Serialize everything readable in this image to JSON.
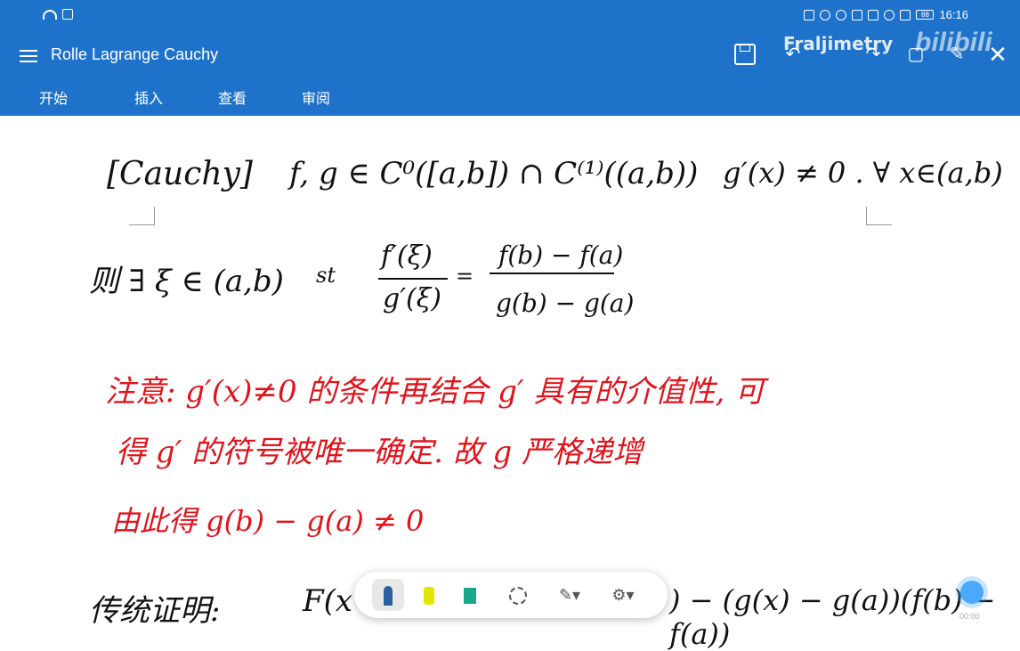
{
  "status": {
    "time": "16:16",
    "battery": "88"
  },
  "header": {
    "title": "Rolle Lagrange Cauchy",
    "watermark": "Fraljimetry",
    "logo": "bilibili",
    "tabs": [
      "开始",
      "插入",
      "查看",
      "审阅"
    ]
  },
  "notes": {
    "line1_label": "[Cauchy]",
    "line1_a": "f, g ∈ C⁰([a,b]) ∩ C⁽¹⁾((a,b))",
    "line1_b": "g′(x) ≠ 0 . ∀ x∈(a,b)",
    "line2_a": "则 ∃ ξ ∈ (a,b)",
    "line2_st": "st",
    "frac1_num": "f′(ξ)",
    "frac1_den": "g′(ξ)",
    "eq": "=",
    "frac2_num": "f(b) − f(a)",
    "frac2_den": "g(b) − g(a)",
    "red1": "注意: g′(x)≠0 的条件再结合 g′ 具有的介值性, 可",
    "red2": "得 g′ 的符号被唯一确定. 故 g 严格递增",
    "red3": "由此得  g(b) − g(a) ≠ 0",
    "bottom_a": "传统证明:",
    "bottom_b": "F(x",
    "bottom_c": ") − (g(x) − g(a))(f(b) − f(a))"
  },
  "toolbar": {
    "pen_icon": "pen-icon",
    "highlighter_icon": "highlighter-icon",
    "marker_icon": "marker-icon",
    "lasso_icon": "lasso-icon",
    "edit_icon": "edit-icon",
    "settings_icon": "settings-icon"
  },
  "fab_time": "00:00"
}
